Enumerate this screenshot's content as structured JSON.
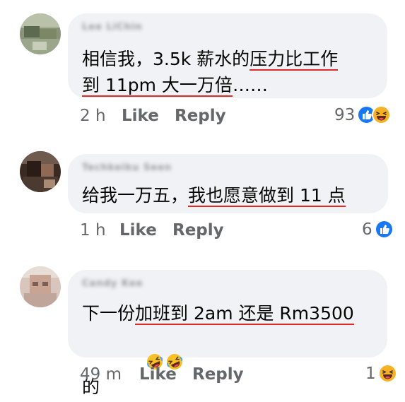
{
  "comments": [
    {
      "author": "Lee LiChin",
      "line1_pre": "相信我，3.5k 薪水的",
      "line1_ul": "压力比工作",
      "line2_ul": "到 11pm 大一万倍",
      "line2_post": "……",
      "time": "2 h",
      "like_label": "Like",
      "reply_label": "Reply",
      "reaction_count": "93",
      "reactions": [
        "like-icon",
        "haha-icon"
      ]
    },
    {
      "author": "Techkeiku Seen",
      "line1_pre": "给我一万五，",
      "line1_ul": "我也愿意做到 11 点",
      "time": "1 h",
      "like_label": "Like",
      "reply_label": "Reply",
      "reaction_count": "6",
      "reactions": [
        "like-icon"
      ]
    },
    {
      "author": "Candy Kee",
      "line1_pre": "下一份",
      "line1_ul": "加班到 2am 还是 Rm3500",
      "line2_pre": "的",
      "line2_emojis": [
        "rofl-emoji",
        "rofl-emoji"
      ],
      "time": "49 m",
      "like_label": "Like",
      "reply_label": "Reply",
      "reaction_count": "1",
      "reactions": [
        "haha-icon"
      ]
    }
  ],
  "colors": {
    "bubble": "#f0f2f5",
    "meta_text": "#65676b",
    "underline": "#e02a2a",
    "like_blue": "#1877f2",
    "haha_yellow": "#f7b125"
  }
}
